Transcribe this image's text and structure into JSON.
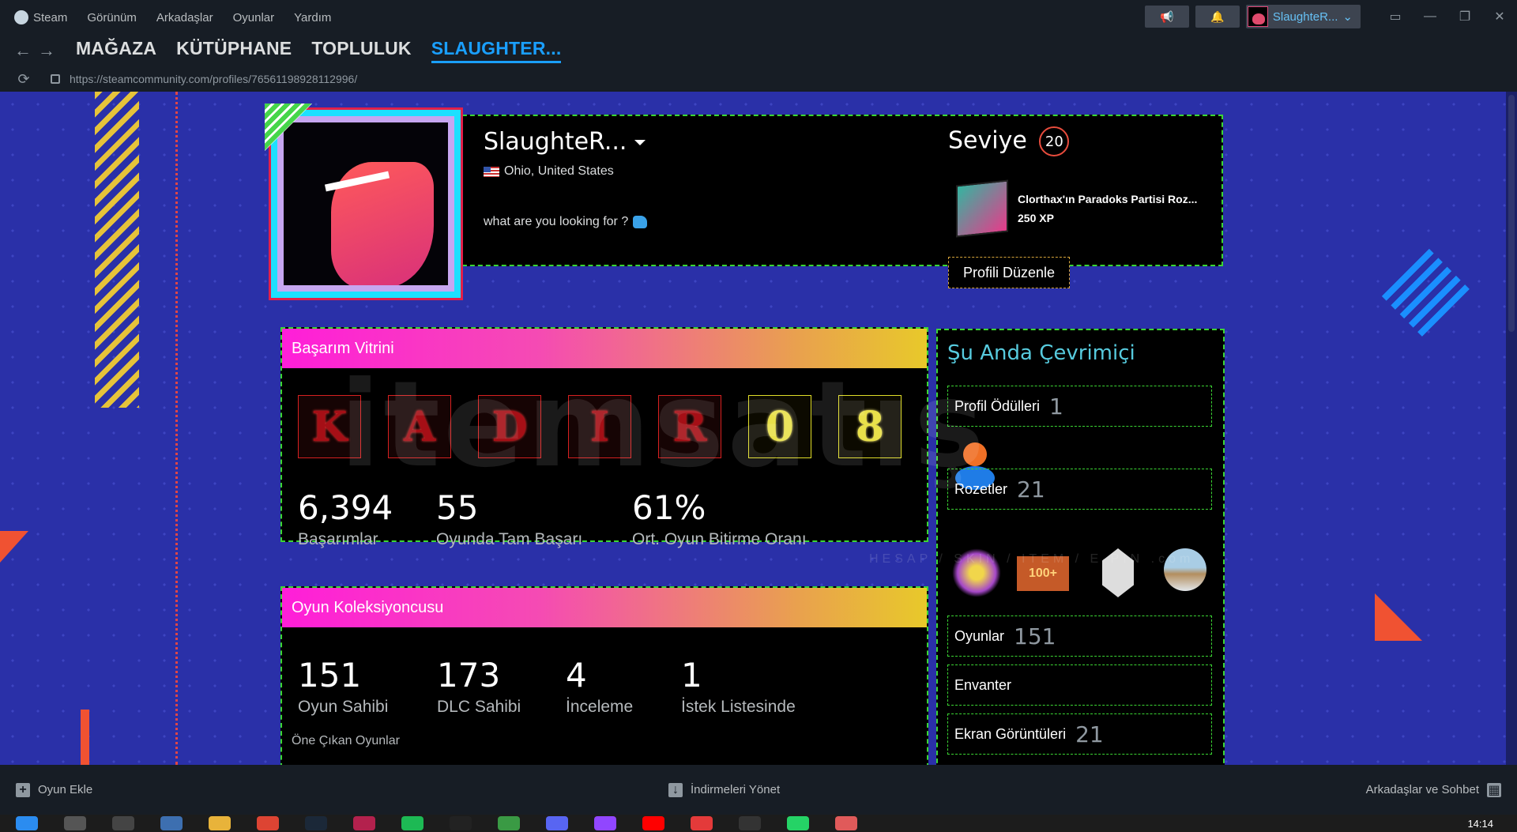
{
  "menu": {
    "app_name": "Steam",
    "items": [
      "Görünüm",
      "Arkadaşlar",
      "Oyunlar",
      "Yardım"
    ]
  },
  "account": {
    "name": "SlaughteR..."
  },
  "nav": {
    "links": [
      "MAĞAZA",
      "KÜTÜPHANE",
      "TOPLULUK",
      "SLAUGHTER..."
    ],
    "active_index": 3
  },
  "url": "https://steamcommunity.com/profiles/76561198928112996/",
  "profile": {
    "persona_name": "SlaughteR...",
    "location": "Ohio, United States",
    "summary": "what are you looking for ?",
    "level_label": "Seviye",
    "level": "20",
    "favorite_badge_name": "Clorthax'ın Paradoks Partisi Roz...",
    "favorite_badge_xp": "250 XP",
    "edit_button": "Profili Düzenle"
  },
  "achievement_showcase": {
    "title": "Başarım Vitrini",
    "tiles": [
      "K",
      "A",
      "D",
      "I",
      "R",
      "0",
      "8"
    ],
    "stats": [
      {
        "value": "6,394",
        "label": "Başarımlar"
      },
      {
        "value": "55",
        "label": "Oyunda Tam Başarı"
      },
      {
        "value": "61%",
        "label": "Ort. Oyun Bitirme Oranı"
      }
    ]
  },
  "game_collector": {
    "title": "Oyun Koleksiyoncusu",
    "stats": [
      {
        "value": "151",
        "label": "Oyun Sahibi"
      },
      {
        "value": "173",
        "label": "DLC Sahibi"
      },
      {
        "value": "4",
        "label": "İnceleme"
      },
      {
        "value": "1",
        "label": "İstek Listesinde"
      }
    ],
    "featured_label": "Öne Çıkan Oyunlar"
  },
  "sidebar": {
    "status": "Şu Anda Çevrimiçi",
    "profile_awards": {
      "label": "Profil Ödülleri",
      "count": "1"
    },
    "badges": {
      "label": "Rozetler",
      "count": "21",
      "badge_100_text": "100+"
    },
    "games": {
      "label": "Oyunlar",
      "count": "151"
    },
    "inventory": {
      "label": "Envanter"
    },
    "screenshots": {
      "label": "Ekran Görüntüleri",
      "count": "21"
    }
  },
  "bottombar": {
    "add_game": "Oyun Ekle",
    "manage_downloads": "İndirmeleri Yönet",
    "friends_chat": "Arkadaşlar ve Sohbet"
  },
  "watermark": {
    "main": "itemsatış",
    "sub": "HESAP / SKIN / ITEM / E-PIN",
    "domain": ".com"
  },
  "taskbar": {
    "time": "14:14"
  },
  "colors": {
    "accent_blue": "#1a9fff",
    "page_bg": "#2a30a8",
    "frame_green": "#3bd633",
    "online_cyan": "#57cbde"
  }
}
